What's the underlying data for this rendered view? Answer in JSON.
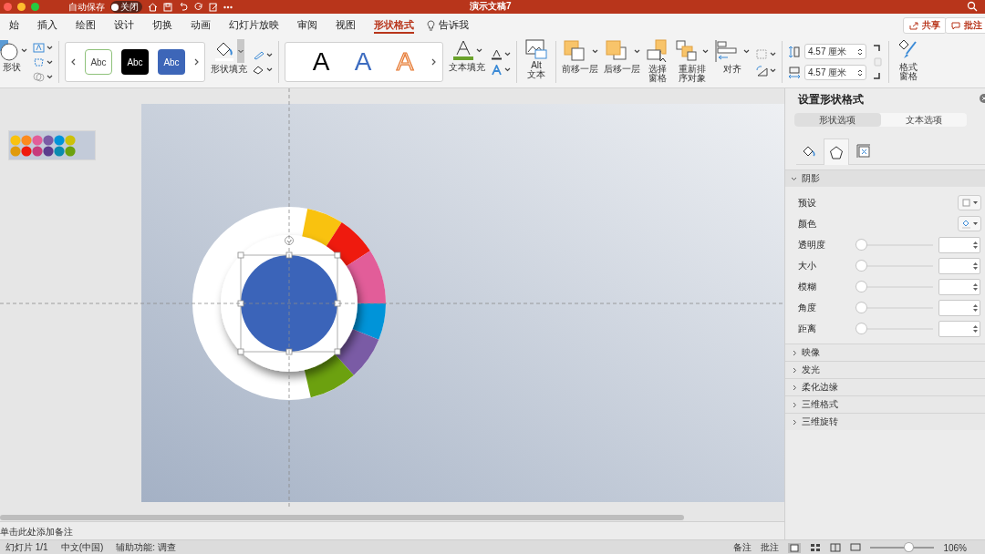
{
  "title_bar": {
    "autosave_label": "自动保存",
    "autosave_toggle": {
      "label": "关闭",
      "on": false
    },
    "document_title": "演示文稿7"
  },
  "tabs": [
    {
      "label": "始",
      "selected": false
    },
    {
      "label": "插入",
      "selected": false
    },
    {
      "label": "绘图",
      "selected": false
    },
    {
      "label": "设计",
      "selected": false
    },
    {
      "label": "切换",
      "selected": false
    },
    {
      "label": "动画",
      "selected": false
    },
    {
      "label": "幻灯片放映",
      "selected": false
    },
    {
      "label": "审阅",
      "selected": false
    },
    {
      "label": "视图",
      "selected": false
    },
    {
      "label": "形状格式",
      "selected": true
    }
  ],
  "tell_me": "告诉我",
  "share_button": "共享",
  "comments_button": "批注",
  "ribbon": {
    "shape_label": "形状",
    "shape_styles": [
      {
        "label": "Abc",
        "kind": "outline"
      },
      {
        "label": "Abc",
        "kind": "dark"
      },
      {
        "label": "Abc",
        "kind": "accent"
      }
    ],
    "shape_fill_label": "形状填充",
    "wordart_styles": [
      {
        "label": "A",
        "kind": "dark"
      },
      {
        "label": "A",
        "kind": "accent"
      },
      {
        "label": "A",
        "kind": "outline"
      }
    ],
    "text_fill_label": "文本填充",
    "alt_text_label": [
      "Alt",
      "文本"
    ],
    "arrange": [
      {
        "kind": "forward",
        "lines": [
          "前移一层"
        ]
      },
      {
        "kind": "backward",
        "lines": [
          "后移一层"
        ]
      },
      {
        "kind": "pane",
        "lines": [
          "选择",
          "窗格"
        ]
      },
      {
        "kind": "reorder",
        "lines": [
          "重新排",
          "序对象"
        ]
      },
      {
        "kind": "align",
        "lines": [
          "对齐"
        ]
      }
    ],
    "size_fields": [
      {
        "kind": "height",
        "value": "4.57 厘米"
      },
      {
        "kind": "width",
        "value": "4.57 厘米"
      }
    ],
    "format_pane_label": [
      "格式",
      "窗格"
    ]
  },
  "format_pane": {
    "title": "设置形状格式",
    "option_tabs": [
      {
        "label": "形状选项",
        "selected": true
      },
      {
        "label": "文本选项",
        "selected": false
      }
    ],
    "icon_tabs": [
      {
        "kind": "fill",
        "selected": false
      },
      {
        "kind": "effects",
        "selected": true
      },
      {
        "kind": "size",
        "selected": false
      }
    ],
    "sections": [
      {
        "label": "阴影",
        "expanded": true,
        "rows": [
          {
            "kind": "preset",
            "label": "预设"
          },
          {
            "kind": "color",
            "label": "颜色"
          },
          {
            "kind": "slider",
            "label": "透明度",
            "level": 0
          },
          {
            "kind": "slider",
            "label": "大小",
            "level": 0
          },
          {
            "kind": "slider",
            "label": "模糊",
            "level": 0
          },
          {
            "kind": "slider",
            "label": "角度",
            "level": 0
          },
          {
            "kind": "slider",
            "label": "距离",
            "level": 0
          }
        ]
      },
      {
        "label": "映像",
        "expanded": false
      },
      {
        "label": "发光",
        "expanded": false
      },
      {
        "label": "柔化边缘",
        "expanded": false
      },
      {
        "label": "三维格式",
        "expanded": false
      },
      {
        "label": "三维旋转",
        "expanded": false
      }
    ]
  },
  "notes": {
    "placeholder": "单击此处添加备注"
  },
  "status_bar": {
    "slide": "幻灯片 1/1",
    "language": "中文(中国)",
    "accessibility": "辅助功能: 调查",
    "notes_button": "备注",
    "comments_button": "批注",
    "zoom_slider": {
      "level": 0.6
    },
    "zoom": "106%"
  }
}
